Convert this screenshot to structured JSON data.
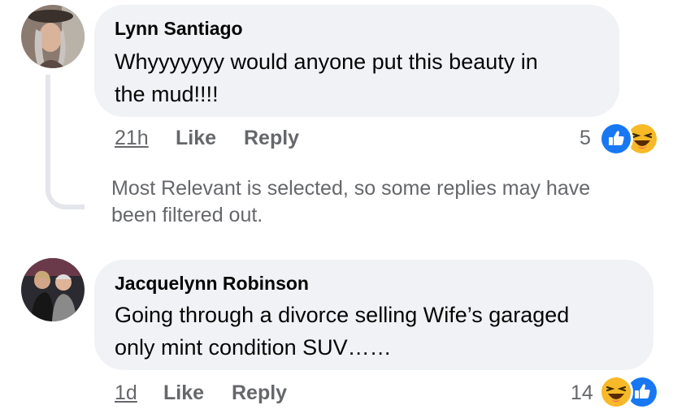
{
  "comments": [
    {
      "author": "Lynn Santiago",
      "text_line1": "Whyyyyyyy would anyone put this beauty in",
      "text_line2": "the mud!!!!",
      "time": "21h",
      "like_label": "Like",
      "reply_label": "Reply",
      "reaction_count": "5",
      "reactions": [
        "like-icon",
        "haha-icon"
      ]
    },
    {
      "author": "Jacquelynn Robinson",
      "text_line1": "Going through a divorce selling Wife’s garaged",
      "text_line2": "only mint condition SUV……",
      "time": "1d",
      "like_label": "Like",
      "reply_label": "Reply",
      "reaction_count": "14",
      "reactions": [
        "haha-icon",
        "like-icon"
      ]
    }
  ],
  "filter_note": "Most Relevant is selected, so some replies may have been filtered out.",
  "colors": {
    "bubble": "#f0f2f5",
    "secondary_text": "#65676b",
    "like_blue": "#1877f2",
    "haha_yellow": "#f7b928"
  }
}
